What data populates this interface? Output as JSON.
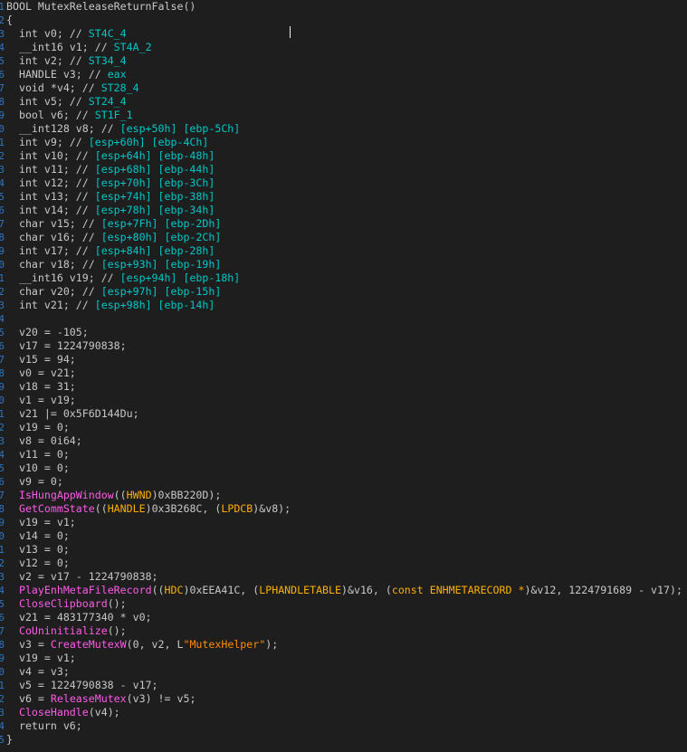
{
  "editor": {
    "caret_visible": true,
    "colors": {
      "background": "#1e1e1e",
      "plain": "#c8c8c8",
      "identifier": "#b8d7ff",
      "comment": "#d0d0d0",
      "register_label": "#00c8c8",
      "function": "#ff5ae8",
      "type": "#ffb000",
      "string": "#ff8c00",
      "gutter": "#2f7fd1"
    },
    "lines": [
      {
        "gutter": "1",
        "tokens": [
          {
            "t": "BOOL MutexReleaseReturnFalse()",
            "c": "plain"
          }
        ]
      },
      {
        "gutter": "2",
        "tokens": [
          {
            "t": "{",
            "c": "plain"
          }
        ]
      },
      {
        "gutter": "3",
        "tokens": [
          {
            "t": "  int v0; // ",
            "c": "plain"
          },
          {
            "t": "ST4C_4",
            "c": "reg"
          }
        ]
      },
      {
        "gutter": "4",
        "tokens": [
          {
            "t": "  __int16 v1; // ",
            "c": "plain"
          },
          {
            "t": "ST4A_2",
            "c": "reg"
          }
        ]
      },
      {
        "gutter": "5",
        "tokens": [
          {
            "t": "  int v2; // ",
            "c": "plain"
          },
          {
            "t": "ST34_4",
            "c": "reg"
          }
        ]
      },
      {
        "gutter": "6",
        "tokens": [
          {
            "t": "  HANDLE v3; // ",
            "c": "plain"
          },
          {
            "t": "eax",
            "c": "reg"
          }
        ]
      },
      {
        "gutter": "7",
        "tokens": [
          {
            "t": "  void *v4; // ",
            "c": "plain"
          },
          {
            "t": "ST28_4",
            "c": "reg"
          }
        ]
      },
      {
        "gutter": "8",
        "tokens": [
          {
            "t": "  int v5; // ",
            "c": "plain"
          },
          {
            "t": "ST24_4",
            "c": "reg"
          }
        ]
      },
      {
        "gutter": "9",
        "tokens": [
          {
            "t": "  bool v6; // ",
            "c": "plain"
          },
          {
            "t": "ST1F_1",
            "c": "reg"
          }
        ]
      },
      {
        "gutter": "0",
        "tokens": [
          {
            "t": "  __int128 v8; // ",
            "c": "plain"
          },
          {
            "t": "[esp+50h] [ebp-5Ch]",
            "c": "reg"
          }
        ]
      },
      {
        "gutter": "1",
        "tokens": [
          {
            "t": "  int v9; // ",
            "c": "plain"
          },
          {
            "t": "[esp+60h] [ebp-4Ch]",
            "c": "reg"
          }
        ]
      },
      {
        "gutter": "2",
        "tokens": [
          {
            "t": "  int v10; // ",
            "c": "plain"
          },
          {
            "t": "[esp+64h] [ebp-48h]",
            "c": "reg"
          }
        ]
      },
      {
        "gutter": "3",
        "tokens": [
          {
            "t": "  int v11; // ",
            "c": "plain"
          },
          {
            "t": "[esp+68h] [ebp-44h]",
            "c": "reg"
          }
        ]
      },
      {
        "gutter": "4",
        "tokens": [
          {
            "t": "  int v12; // ",
            "c": "plain"
          },
          {
            "t": "[esp+70h] [ebp-3Ch]",
            "c": "reg"
          }
        ]
      },
      {
        "gutter": "5",
        "tokens": [
          {
            "t": "  int v13; // ",
            "c": "plain"
          },
          {
            "t": "[esp+74h] [ebp-38h]",
            "c": "reg"
          }
        ]
      },
      {
        "gutter": "6",
        "tokens": [
          {
            "t": "  int v14; // ",
            "c": "plain"
          },
          {
            "t": "[esp+78h] [ebp-34h]",
            "c": "reg"
          }
        ]
      },
      {
        "gutter": "7",
        "tokens": [
          {
            "t": "  char v15; // ",
            "c": "plain"
          },
          {
            "t": "[esp+7Fh] [ebp-2Dh]",
            "c": "reg"
          }
        ]
      },
      {
        "gutter": "8",
        "tokens": [
          {
            "t": "  char v16; // ",
            "c": "plain"
          },
          {
            "t": "[esp+80h] [ebp-2Ch]",
            "c": "reg"
          }
        ]
      },
      {
        "gutter": "9",
        "tokens": [
          {
            "t": "  int v17; // ",
            "c": "plain"
          },
          {
            "t": "[esp+84h] [ebp-28h]",
            "c": "reg"
          }
        ]
      },
      {
        "gutter": "0",
        "tokens": [
          {
            "t": "  char v18; // ",
            "c": "plain"
          },
          {
            "t": "[esp+93h] [ebp-19h]",
            "c": "reg"
          }
        ]
      },
      {
        "gutter": "1",
        "tokens": [
          {
            "t": "  __int16 v19; // ",
            "c": "plain"
          },
          {
            "t": "[esp+94h] [ebp-18h]",
            "c": "reg"
          }
        ]
      },
      {
        "gutter": "2",
        "tokens": [
          {
            "t": "  char v20; // ",
            "c": "plain"
          },
          {
            "t": "[esp+97h] [ebp-15h]",
            "c": "reg"
          }
        ]
      },
      {
        "gutter": "3",
        "tokens": [
          {
            "t": "  int v21; // ",
            "c": "plain"
          },
          {
            "t": "[esp+98h] [ebp-14h]",
            "c": "reg"
          }
        ]
      },
      {
        "gutter": "4",
        "tokens": [
          {
            "t": "",
            "c": "plain"
          }
        ]
      },
      {
        "gutter": "5",
        "tokens": [
          {
            "t": "  v20 = -105;",
            "c": "plain"
          }
        ]
      },
      {
        "gutter": "6",
        "tokens": [
          {
            "t": "  v17 = 1224790838;",
            "c": "plain"
          }
        ]
      },
      {
        "gutter": "7",
        "tokens": [
          {
            "t": "  v15 = 94;",
            "c": "plain"
          }
        ]
      },
      {
        "gutter": "8",
        "tokens": [
          {
            "t": "  v0 = v21;",
            "c": "plain"
          }
        ]
      },
      {
        "gutter": "9",
        "tokens": [
          {
            "t": "  v18 = 31;",
            "c": "plain"
          }
        ]
      },
      {
        "gutter": "0",
        "tokens": [
          {
            "t": "  v1 = v19;",
            "c": "plain"
          }
        ]
      },
      {
        "gutter": "1",
        "tokens": [
          {
            "t": "  v21 |= 0x5F6D144Du;",
            "c": "plain"
          }
        ]
      },
      {
        "gutter": "2",
        "tokens": [
          {
            "t": "  v19 = 0;",
            "c": "plain"
          }
        ]
      },
      {
        "gutter": "3",
        "tokens": [
          {
            "t": "  v8 = 0i64;",
            "c": "plain"
          }
        ]
      },
      {
        "gutter": "4",
        "tokens": [
          {
            "t": "  v11 = 0;",
            "c": "plain"
          }
        ]
      },
      {
        "gutter": "5",
        "tokens": [
          {
            "t": "  v10 = 0;",
            "c": "plain"
          }
        ]
      },
      {
        "gutter": "6",
        "tokens": [
          {
            "t": "  v9 = 0;",
            "c": "plain"
          }
        ]
      },
      {
        "gutter": "7",
        "tokens": [
          {
            "t": "  ",
            "c": "plain"
          },
          {
            "t": "IsHungAppWindow",
            "c": "func"
          },
          {
            "t": "((",
            "c": "plain"
          },
          {
            "t": "HWND",
            "c": "type"
          },
          {
            "t": ")0xBB220D);",
            "c": "plain"
          }
        ]
      },
      {
        "gutter": "8",
        "tokens": [
          {
            "t": "  ",
            "c": "plain"
          },
          {
            "t": "GetCommState",
            "c": "func"
          },
          {
            "t": "((",
            "c": "plain"
          },
          {
            "t": "HANDLE",
            "c": "type"
          },
          {
            "t": ")0x3B268C, (",
            "c": "plain"
          },
          {
            "t": "LPDCB",
            "c": "type"
          },
          {
            "t": ")&v8);",
            "c": "plain"
          }
        ]
      },
      {
        "gutter": "9",
        "tokens": [
          {
            "t": "  v19 = v1;",
            "c": "plain"
          }
        ]
      },
      {
        "gutter": "0",
        "tokens": [
          {
            "t": "  v14 = 0;",
            "c": "plain"
          }
        ]
      },
      {
        "gutter": "1",
        "tokens": [
          {
            "t": "  v13 = 0;",
            "c": "plain"
          }
        ]
      },
      {
        "gutter": "2",
        "tokens": [
          {
            "t": "  v12 = 0;",
            "c": "plain"
          }
        ]
      },
      {
        "gutter": "3",
        "tokens": [
          {
            "t": "  v2 = v17 - 1224790838;",
            "c": "plain"
          }
        ]
      },
      {
        "gutter": "4",
        "tokens": [
          {
            "t": "  ",
            "c": "plain"
          },
          {
            "t": "PlayEnhMetaFileRecord",
            "c": "func"
          },
          {
            "t": "((",
            "c": "plain"
          },
          {
            "t": "HDC",
            "c": "type"
          },
          {
            "t": ")0xEEA41C, (",
            "c": "plain"
          },
          {
            "t": "LPHANDLETABLE",
            "c": "type"
          },
          {
            "t": ")&v16, (",
            "c": "plain"
          },
          {
            "t": "const ENHMETARECORD *",
            "c": "type"
          },
          {
            "t": ")&v12, 1224791689 - v17);",
            "c": "plain"
          }
        ]
      },
      {
        "gutter": "5",
        "tokens": [
          {
            "t": "  ",
            "c": "plain"
          },
          {
            "t": "CloseClipboard",
            "c": "func"
          },
          {
            "t": "();",
            "c": "plain"
          }
        ]
      },
      {
        "gutter": "6",
        "tokens": [
          {
            "t": "  v21 = 483177340 * v0;",
            "c": "plain"
          }
        ]
      },
      {
        "gutter": "7",
        "tokens": [
          {
            "t": "  ",
            "c": "plain"
          },
          {
            "t": "CoUninitialize",
            "c": "func"
          },
          {
            "t": "();",
            "c": "plain"
          }
        ]
      },
      {
        "gutter": "8",
        "tokens": [
          {
            "t": "  v3 = ",
            "c": "plain"
          },
          {
            "t": "CreateMutexW",
            "c": "func"
          },
          {
            "t": "(0, v2, L",
            "c": "plain"
          },
          {
            "t": "\"MutexHelper\"",
            "c": "str"
          },
          {
            "t": ");",
            "c": "plain"
          }
        ]
      },
      {
        "gutter": "9",
        "tokens": [
          {
            "t": "  v19 = v1;",
            "c": "plain"
          }
        ]
      },
      {
        "gutter": "0",
        "tokens": [
          {
            "t": "  v4 = v3;",
            "c": "plain"
          }
        ]
      },
      {
        "gutter": "1",
        "tokens": [
          {
            "t": "  v5 = 1224790838 - v17;",
            "c": "plain"
          }
        ]
      },
      {
        "gutter": "2",
        "tokens": [
          {
            "t": "  v6 = ",
            "c": "plain"
          },
          {
            "t": "ReleaseMutex",
            "c": "func"
          },
          {
            "t": "(v3) != v5;",
            "c": "plain"
          }
        ]
      },
      {
        "gutter": "3",
        "tokens": [
          {
            "t": "  ",
            "c": "plain"
          },
          {
            "t": "CloseHandle",
            "c": "func"
          },
          {
            "t": "(v4);",
            "c": "plain"
          }
        ]
      },
      {
        "gutter": "4",
        "tokens": [
          {
            "t": "  return v6;",
            "c": "plain"
          }
        ]
      },
      {
        "gutter": "5",
        "tokens": [
          {
            "t": "}",
            "c": "plain"
          }
        ]
      }
    ]
  }
}
